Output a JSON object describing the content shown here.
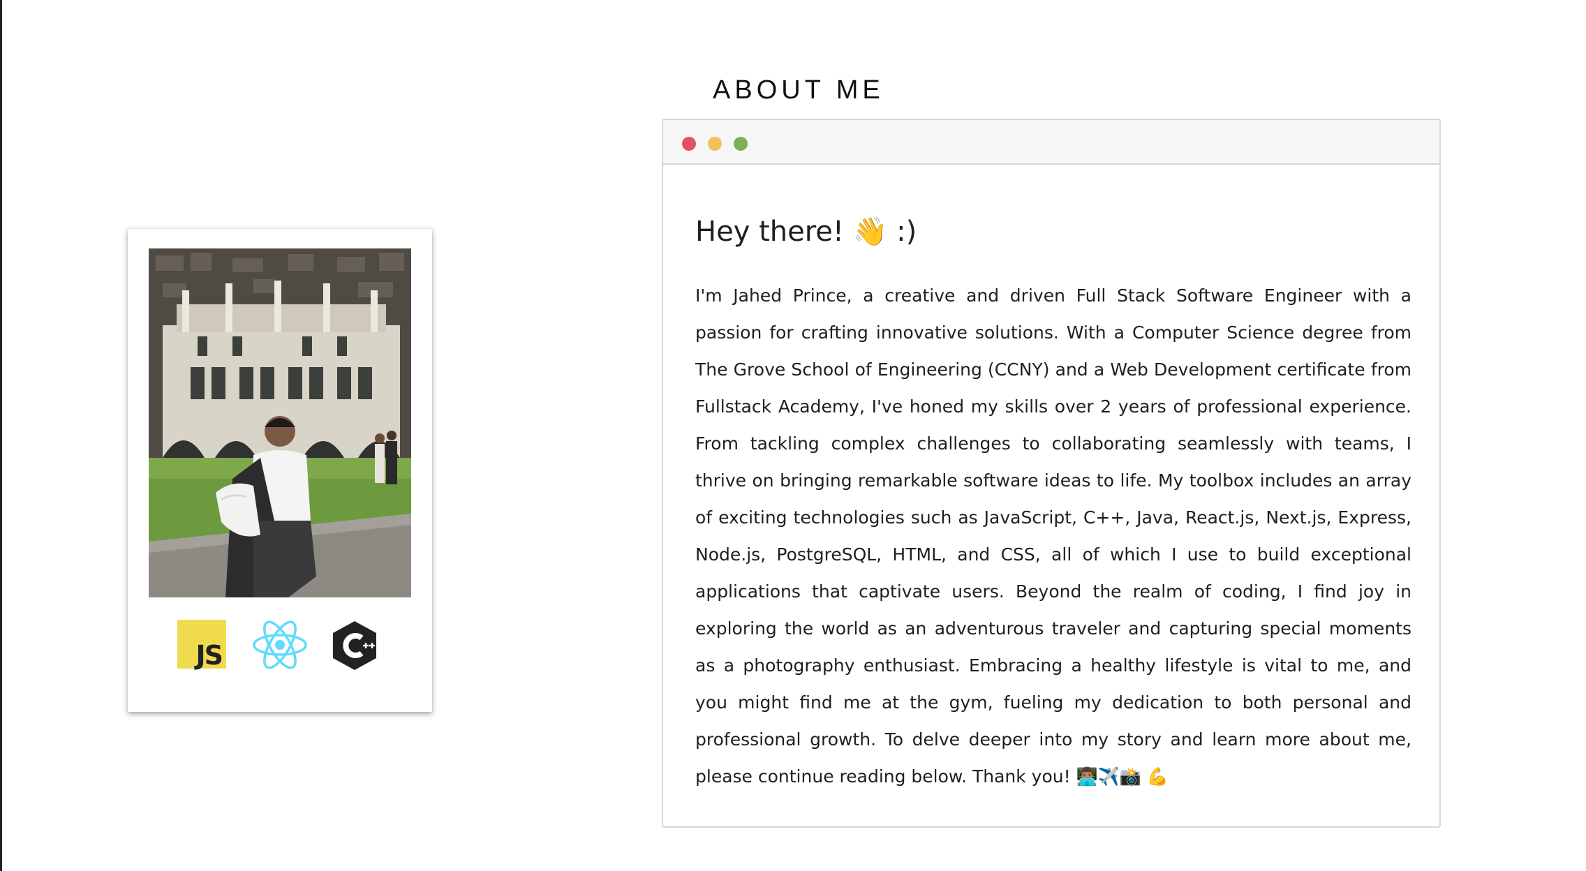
{
  "page": {
    "section_title": "ABOUT ME"
  },
  "profile_card": {
    "photo_alt": "Jahed Prince graduation photo",
    "tech_icons": [
      "javascript-icon",
      "react-icon",
      "cplusplus-icon"
    ],
    "js_label": "JS"
  },
  "window": {
    "controls": {
      "close_color": "#e0555b",
      "minimize_color": "#f0c35a",
      "maximize_color": "#7fae5a"
    },
    "greeting": "Hey there! 👋 :)",
    "bio": "I'm Jahed Prince, a creative and driven Full Stack Software Engineer with a passion for crafting innovative solutions. With a Computer Science degree from The Grove School of Engineering (CCNY) and a Web Development certificate from Fullstack Academy, I've honed my skills over 2 years of professional experience. From tackling complex challenges to collaborating seamlessly with teams, I thrive on bringing remarkable software ideas to life. My toolbox includes an array of exciting technologies such as JavaScript, C++, Java, React.js, Next.js, Express, Node.js, PostgreSQL, HTML, and CSS, all of which I use to build exceptional applications that captivate users. Beyond the realm of coding, I find joy in exploring the world as an adventurous traveler and capturing special moments as a photography enthusiast. Embracing a healthy lifestyle is vital to me, and you might find me at the gym, fueling my dedication to both personal and professional growth. To delve deeper into my story and learn more about me, please continue reading below. Thank you! 👨🏽‍💻✈️📸 💪"
  },
  "colors": {
    "js_yellow": "#f0db4f",
    "react_blue": "#61dafb",
    "cpp_dark": "#222222"
  }
}
